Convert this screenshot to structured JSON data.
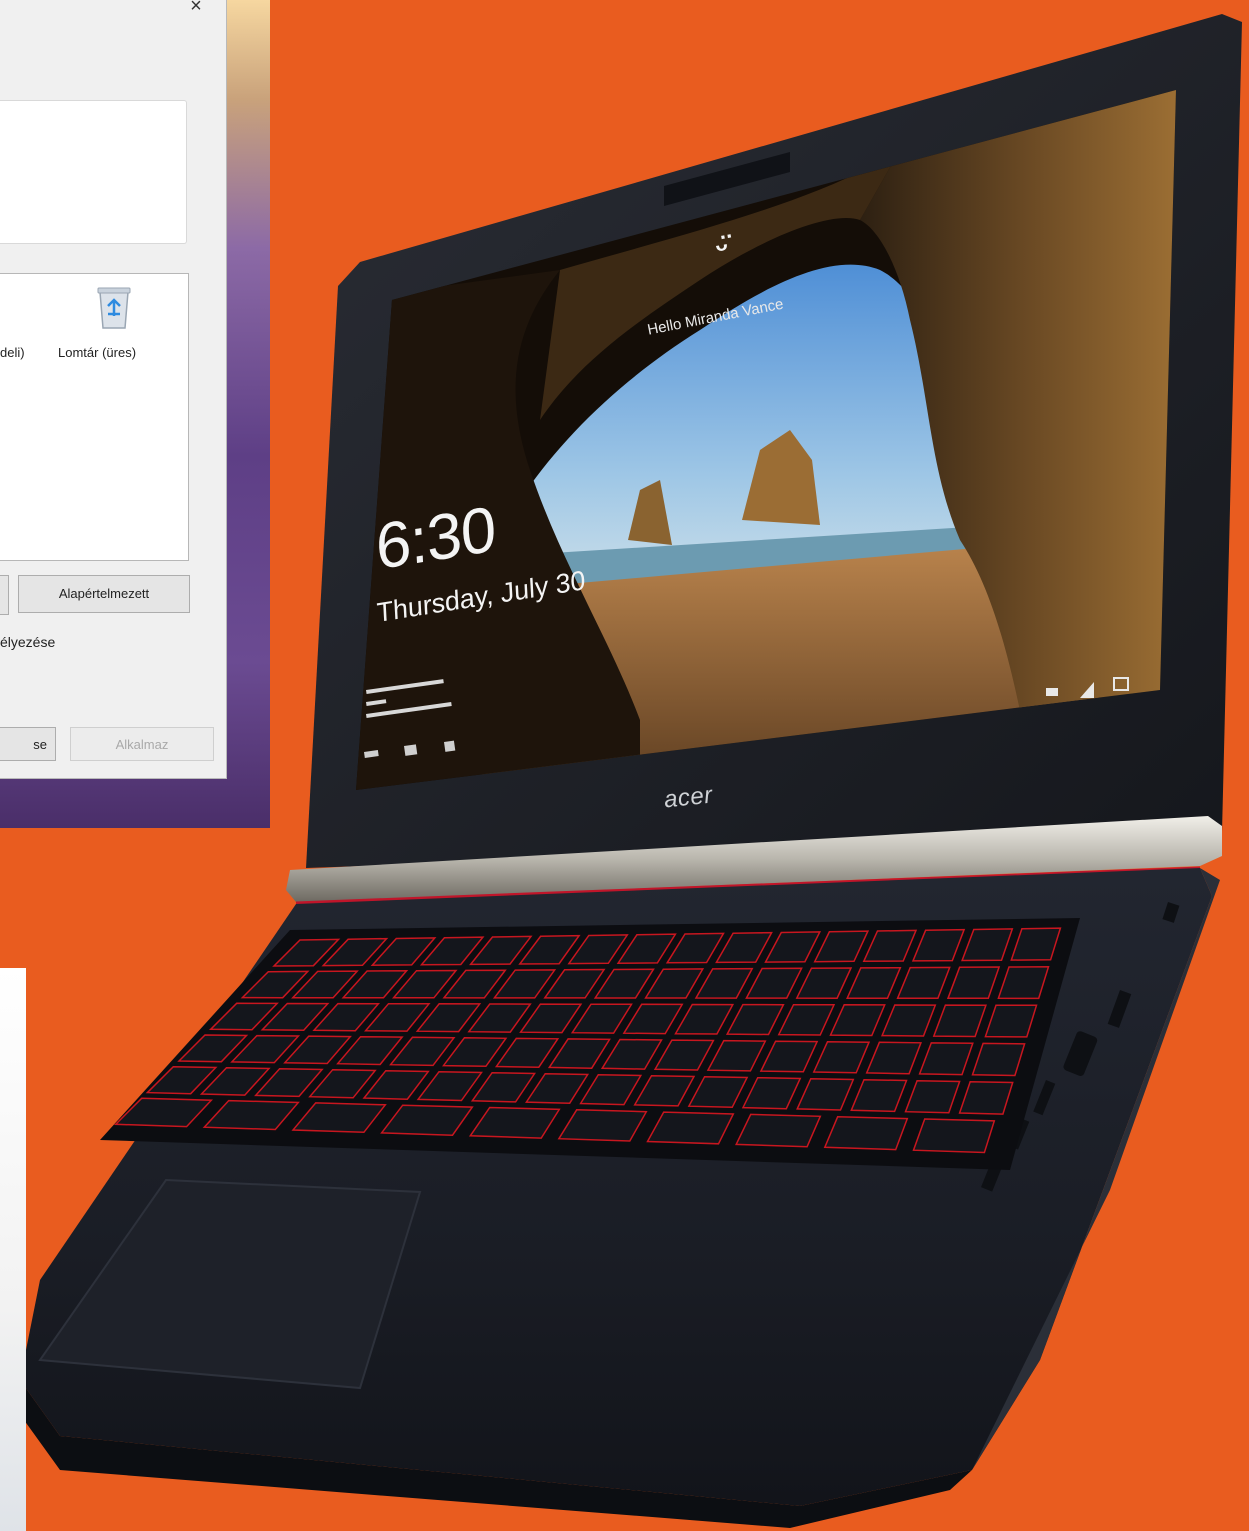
{
  "dialog": {
    "close_glyph": "×",
    "icon_left_label": "deli)",
    "recycle_label": "Lomtár (üres)",
    "default_button": "Alapértelmezett",
    "checkbox_text": "élyezése",
    "ok_button": "se",
    "apply_button": "Alkalmaz"
  },
  "laptop": {
    "brand": "acer",
    "lock_time": "6:30",
    "lock_date": "Thursday, July 30",
    "greeting": "Hello Miranda Vance",
    "smile": "ᵕ̈"
  },
  "colors": {
    "background": "#e95c1f",
    "keyboard_backlight": "#d02020",
    "laptop_body": "#1b1e26"
  }
}
